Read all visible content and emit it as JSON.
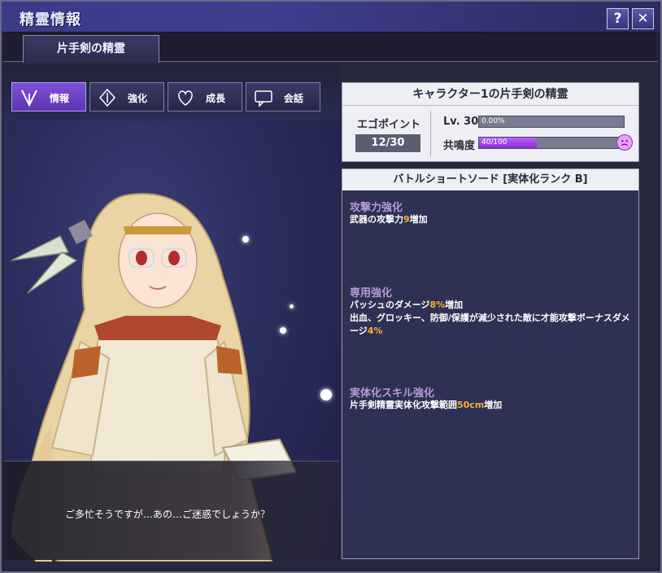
{
  "window": {
    "title": "精霊情報",
    "help_label": "?",
    "close_label": "✕"
  },
  "tabs": [
    {
      "label": "片手剣の精霊"
    }
  ],
  "menu": [
    {
      "label": "情報",
      "icon": "info-icon",
      "active": true
    },
    {
      "label": "強化",
      "icon": "enhance-icon",
      "active": false
    },
    {
      "label": "成長",
      "icon": "growth-icon",
      "active": false
    },
    {
      "label": "会話",
      "icon": "chat-icon",
      "active": false
    }
  ],
  "info": {
    "title": "キャラクター1の片手剣の精霊",
    "ego_label": "エゴポイント",
    "ego_value": "12/30",
    "level_label": "Lv. 30",
    "level_bar_text": "0.00%",
    "level_progress": 0.0,
    "resonance_label": "共鳴度",
    "resonance_bar_text": "40/100",
    "resonance_progress": 0.4,
    "mood_icon": "sad-face-icon"
  },
  "weapon": {
    "name": "バトルショートソード [実体化ランク B]",
    "sections": [
      {
        "title": "攻撃力強化",
        "lines": [
          [
            "武器の攻撃力",
            "9",
            "増加"
          ]
        ]
      },
      {
        "title": "専用強化",
        "lines": [
          [
            "パッシュのダメージ",
            "8%",
            "増加"
          ],
          [
            "出血、グロッキー、防御/保護が減少された敵に才能攻撃ボーナスダメージ",
            "4%",
            ""
          ]
        ]
      },
      {
        "title": "実体化スキル強化",
        "lines": [
          [
            "片手剣精霊実体化攻撃範囲",
            "50cm",
            "増加"
          ]
        ]
      }
    ]
  },
  "dialog": {
    "text": "ご多忙そうですが…あの…ご迷惑でしょうか？"
  },
  "colors": {
    "accent": "#7e52d8",
    "highlight": "#ffb02e",
    "section_title": "#b59ad8",
    "bar_fill": "#a040e8"
  }
}
